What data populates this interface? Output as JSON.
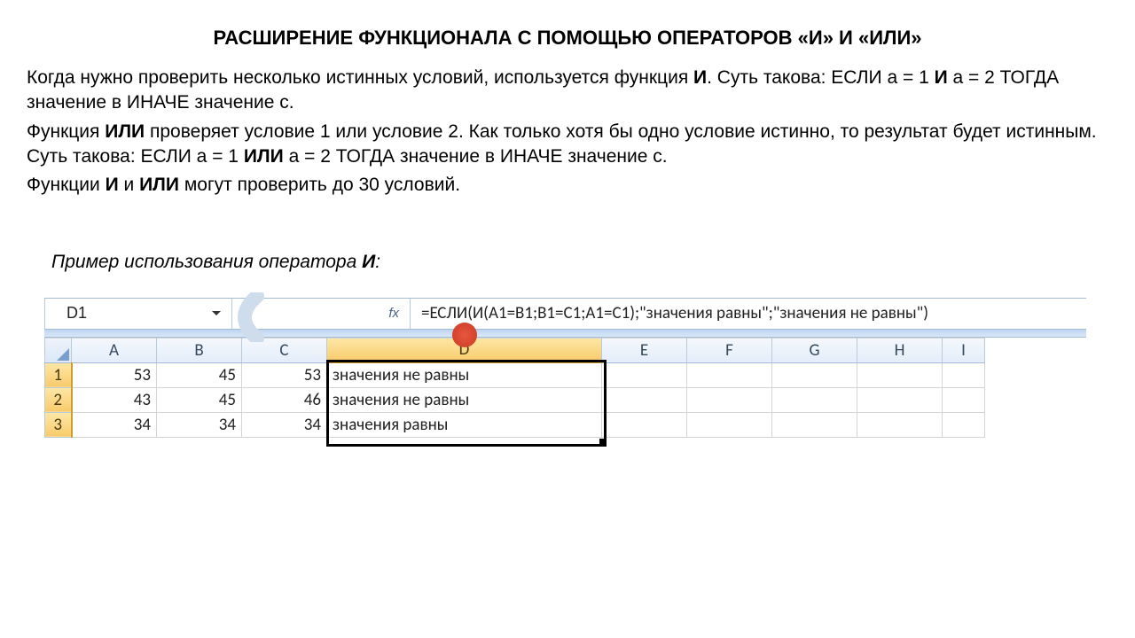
{
  "title": "РАСШИРЕНИЕ ФУНКЦИОНАЛА С ПОМОЩЬЮ ОПЕРАТОРОВ «И» И «ИЛИ»",
  "para1_a": "Когда нужно проверить несколько истинных условий, используется функция ",
  "para1_b": "И",
  "para1_c": ". Суть такова: ЕСЛИ а = 1 ",
  "para1_d": "И",
  "para1_e": " а = 2 ТОГДА значение в ИНАЧЕ значение с.",
  "para2_a": "Функция ",
  "para2_b": "ИЛИ",
  "para2_c": " проверяет условие 1 или условие 2. Как только хотя бы одно условие истинно, то результат будет истинным. Суть такова: ЕСЛИ а = 1 ",
  "para2_d": "ИЛИ",
  "para2_e": " а = 2 ТОГДА значение в ИНАЧЕ значение с.",
  "para3_a": "Функции ",
  "para3_b": "И",
  "para3_c": " и ",
  "para3_d": "ИЛИ",
  "para3_e": " могут проверить до 30 условий.",
  "caption_a": "Пример использования оператора ",
  "caption_b": "И",
  "caption_c": ":",
  "excel": {
    "namebox": "D1",
    "fx_label": "fx",
    "formula": "=ЕСЛИ(И(A1=B1;B1=C1;A1=C1);\"значения равны\";\"значения не равны\")",
    "cols": [
      "A",
      "B",
      "C",
      "D",
      "E",
      "F",
      "G",
      "H",
      "I"
    ],
    "rows": [
      {
        "h": "1",
        "A": "53",
        "B": "45",
        "C": "53",
        "D": "значения не равны"
      },
      {
        "h": "2",
        "A": "43",
        "B": "45",
        "C": "46",
        "D": "значения не равны"
      },
      {
        "h": "3",
        "A": "34",
        "B": "34",
        "C": "34",
        "D": "значения равны"
      }
    ]
  }
}
